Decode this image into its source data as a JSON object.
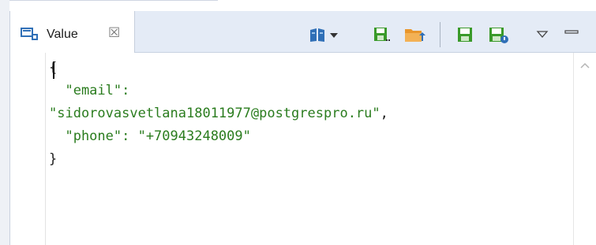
{
  "tab": {
    "label": "Value",
    "close_glyph": "☒",
    "icon": "value-panel-icon"
  },
  "toolbar": {
    "icons": [
      "book-icon",
      "dropdown-arrow-icon",
      "save-to-file-icon",
      "load-from-file-icon",
      "save-icon",
      "save-as-icon",
      "view-menu-icon",
      "minimize-icon"
    ]
  },
  "editor": {
    "lines": [
      {
        "parts": [
          {
            "text": "{",
            "style": "plain"
          }
        ]
      },
      {
        "parts": [
          {
            "text": "  \"email\":",
            "style": "str"
          }
        ]
      },
      {
        "parts": [
          {
            "text": "\"sidorovasvetlana18011977@postgrespro.ru\"",
            "style": "str"
          },
          {
            "text": ",",
            "style": "plain"
          }
        ]
      },
      {
        "parts": [
          {
            "text": "  \"phone\": \"+70943248009\"",
            "style": "str"
          }
        ]
      },
      {
        "parts": [
          {
            "text": "}",
            "style": "plain"
          }
        ]
      }
    ]
  },
  "colors": {
    "string": "#2a7c1e",
    "text": "#1b1b1b",
    "tabbar_bg": "#e4ebf6",
    "icon_green": "#3a9a2a",
    "icon_blue": "#2f6fb7",
    "icon_orange": "#e9962c"
  }
}
